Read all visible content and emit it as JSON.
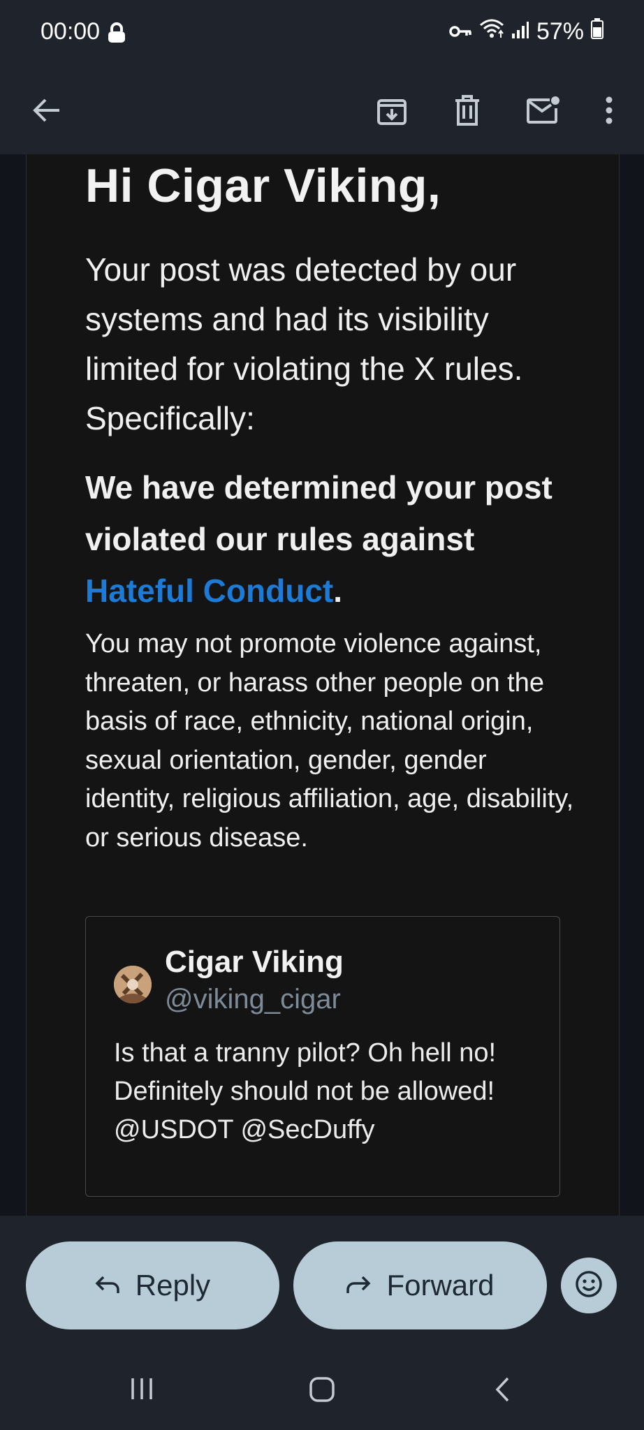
{
  "status_bar": {
    "time": "00:00",
    "battery": "57%",
    "icons": [
      "lock-icon",
      "key-icon",
      "wifi-icon",
      "signal-icon",
      "battery-icon"
    ]
  },
  "toolbar": {
    "icons": [
      "back-arrow-icon",
      "archive-icon",
      "delete-icon",
      "mark-unread-icon",
      "more-vert-icon"
    ]
  },
  "email": {
    "greeting": "Hi Cigar Viking,",
    "intro": "Your post was detected by our systems and had its visibility limited for violating the X rules. Specifically:",
    "rule_prefix": "We have determined your post violated our rules against ",
    "rule_link": "Hateful Conduct",
    "rule_suffix": ".",
    "description": "You may not promote violence against, threaten, or harass other people on the basis of race, ethnicity, national origin, sexual orientation, gender, gender identity, religious affiliation, age, disability, or serious disease.",
    "quoted_post": {
      "name": "Cigar Viking",
      "handle": "@viking_cigar",
      "text": "Is that a tranny pilot? Oh hell no! Definitely should not be allowed! @USDOT @SecDuffy"
    },
    "link_color": "#1d7bd8"
  },
  "actions": {
    "reply_label": "Reply",
    "forward_label": "Forward",
    "button_color": "#b8ccd8"
  },
  "system_nav": {
    "icons": [
      "recents-icon",
      "home-icon",
      "back-icon"
    ]
  }
}
